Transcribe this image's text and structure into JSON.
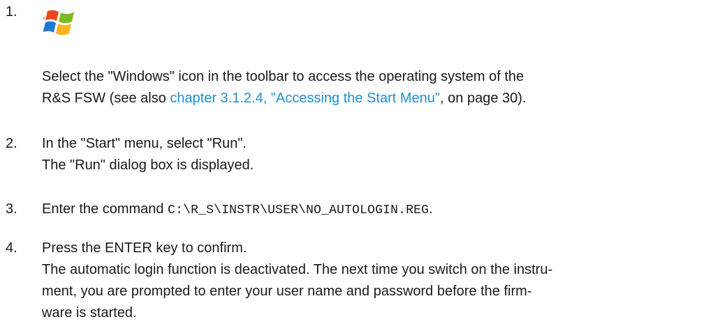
{
  "steps": [
    {
      "number": "1.",
      "icon": "windows-logo-icon",
      "lines": {
        "l1": "Select the \"Windows\" icon in the toolbar to access the operating system of the",
        "l2_pre": "R&S FSW (see also ",
        "l2_link": "chapter 3.1.2.4, \"Accessing the Start Menu\"",
        "l2_post": ", on page 30)."
      }
    },
    {
      "number": "2.",
      "lines": {
        "l1": "In the \"Start\" menu, select \"Run\".",
        "l2": "The \"Run\" dialog box is displayed."
      }
    },
    {
      "number": "3.",
      "lines": {
        "pre": "Enter the command ",
        "code": "C:\\R_S\\INSTR\\USER\\NO_AUTOLOGIN.REG",
        "post": "."
      }
    },
    {
      "number": "4.",
      "lines": {
        "l1": "Press the ENTER key to confirm.",
        "l2": "The automatic login function is deactivated. The next time you switch on the instru-",
        "l3": "ment, you are prompted to enter your user name and password before the firm-",
        "l4": "ware is started."
      }
    }
  ],
  "colors": {
    "text": "#1a1a1a",
    "link": "#1f8fcf"
  }
}
